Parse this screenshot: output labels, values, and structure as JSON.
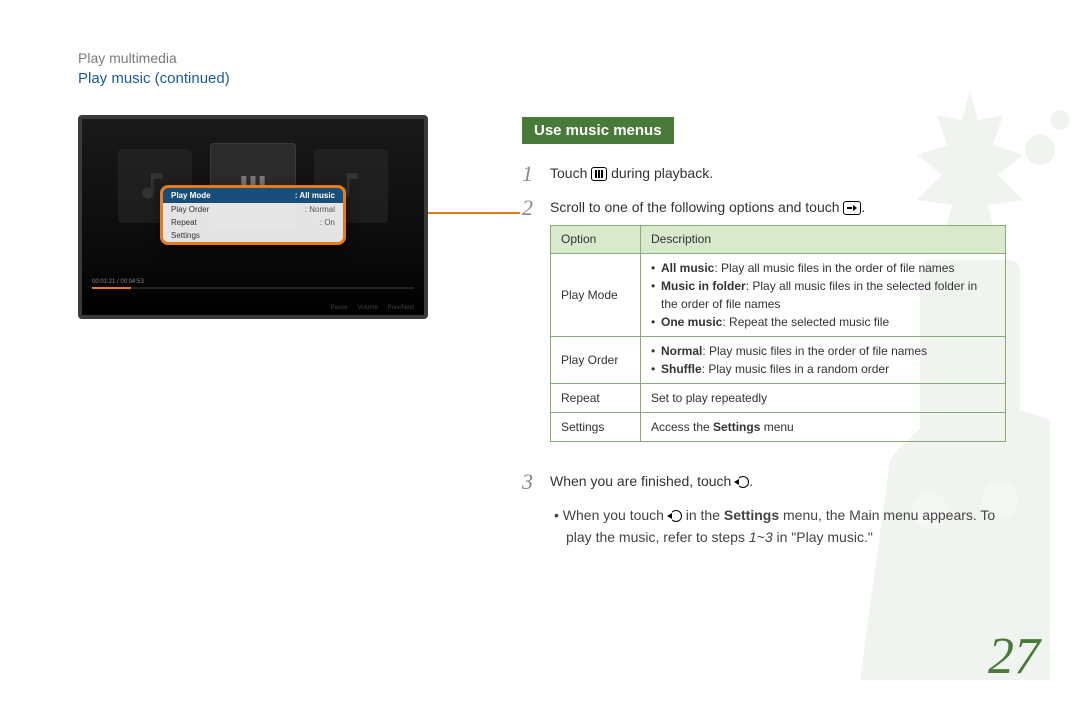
{
  "breadcrumb": "Play multimedia",
  "section_title": "Play music  (continued)",
  "pill": "Use music menus",
  "screenshot": {
    "popup": {
      "head_left": "Play Mode",
      "head_right": ": All music",
      "rows": [
        {
          "label": "Play Order",
          "value": ": Normal"
        },
        {
          "label": "Repeat",
          "value": ": On"
        },
        {
          "label": "Settings",
          "value": ""
        }
      ]
    },
    "time": "00:01:21 / 00:04:53",
    "footbar": [
      "Pause",
      "Volume",
      "Prev/Next"
    ]
  },
  "steps": {
    "s1_a": "Touch ",
    "s1_b": " during playback.",
    "s2_a": "Scroll to one of the following options and touch ",
    "s2_b": ".",
    "s3_a": "When you are finished, touch ",
    "s3_b": "."
  },
  "table": {
    "headers": [
      "Option",
      "Description"
    ],
    "rows": [
      {
        "option": "Play Mode",
        "items": [
          {
            "bold": "All music",
            "rest": ": Play all music files in the order of file names"
          },
          {
            "bold": "Music in folder",
            "rest": ": Play all music files in the selected folder in the order of file names"
          },
          {
            "bold": "One music",
            "rest": ": Repeat the selected music file"
          }
        ]
      },
      {
        "option": "Play Order",
        "items": [
          {
            "bold": "Normal",
            "rest": ": Play music files in the order of file names"
          },
          {
            "bold": "Shuffle",
            "rest": ": Play music files in a random order"
          }
        ]
      },
      {
        "option": "Repeat",
        "plain": "Set to play repeatedly"
      },
      {
        "option": "Settings",
        "html": "Access the <b>Settings</b> menu"
      }
    ]
  },
  "note_a": "When you touch ",
  "note_b": " in the ",
  "note_bold1": "Settings",
  "note_c": " menu, the Main menu appears. To play the music, refer to steps ",
  "note_em": "1~3",
  "note_d": " in \"Play music.\"",
  "page_number": "27"
}
